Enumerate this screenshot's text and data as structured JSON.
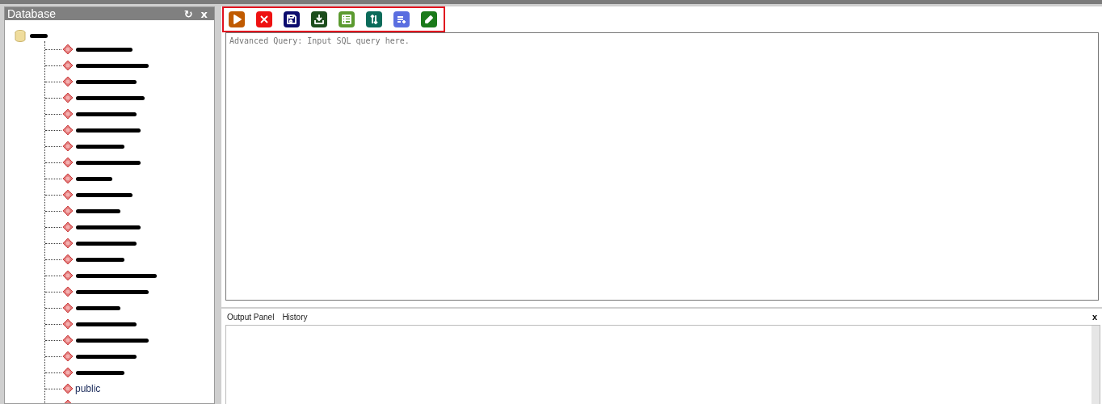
{
  "sidebar": {
    "title": "Database",
    "refresh_icon": "↻",
    "close_icon": "x",
    "tree": {
      "kind": "redacted",
      "children": [
        {
          "kind": "redacted"
        },
        {
          "kind": "redacted"
        },
        {
          "kind": "redacted"
        },
        {
          "kind": "redacted"
        },
        {
          "kind": "redacted"
        },
        {
          "kind": "redacted"
        },
        {
          "kind": "redacted"
        },
        {
          "kind": "redacted"
        },
        {
          "kind": "redacted"
        },
        {
          "kind": "redacted"
        },
        {
          "kind": "redacted"
        },
        {
          "kind": "redacted"
        },
        {
          "kind": "redacted"
        },
        {
          "kind": "redacted"
        },
        {
          "kind": "redacted"
        },
        {
          "kind": "redacted"
        },
        {
          "kind": "redacted"
        },
        {
          "kind": "redacted"
        },
        {
          "kind": "redacted"
        },
        {
          "kind": "redacted"
        },
        {
          "kind": "redacted"
        },
        {
          "kind": "label",
          "label": "public"
        },
        {
          "kind": "redacted"
        }
      ]
    }
  },
  "toolbar": {
    "highlighted": true,
    "buttons": [
      {
        "kind": "run",
        "color": "#c05a00"
      },
      {
        "kind": "stop",
        "color": "#ee1111"
      },
      {
        "kind": "save",
        "color": "#0b0b6e"
      },
      {
        "kind": "download",
        "color": "#1c4d1c"
      },
      {
        "kind": "table",
        "color": "#5b9a2f"
      },
      {
        "kind": "sort",
        "color": "#0b6b5a"
      },
      {
        "kind": "add-list",
        "color": "#5a6ee0"
      },
      {
        "kind": "edit",
        "color": "#1a7a1a"
      }
    ]
  },
  "editor": {
    "placeholder": "Advanced Query: Input SQL query here."
  },
  "output": {
    "tabs": [
      {
        "label": "Output Panel"
      },
      {
        "label": "History"
      }
    ],
    "close_icon": "x"
  }
}
